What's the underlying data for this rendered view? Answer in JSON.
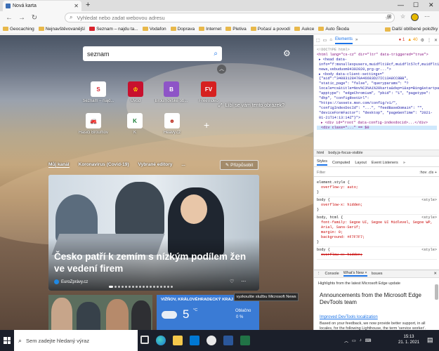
{
  "browser": {
    "tab_title": "Nová karta",
    "address_placeholder": "Vyhledat nebo zadat webovou adresu",
    "bookmarks": [
      "Geocaching",
      "Nejnavštěvovanější",
      "Seznam – najdu ta...",
      "Vodafon",
      "Doprava",
      "Internet",
      "Pletiva",
      "Počasí a povodí",
      "Aukce",
      "Auto Škoda"
    ],
    "bookmarks_more": "Další oblíbené položky"
  },
  "ntp": {
    "search_value": "seznam",
    "like_text": "Líbí se vám tento obrázek?",
    "tiles": [
      {
        "label": "Seznam – najd...",
        "glyph": "S",
        "color": "#d9232d"
      },
      {
        "label": "Úvod",
        "glyph": "♔",
        "color": "#c8102e"
      },
      {
        "label": "Broumovské ob...",
        "glyph": "B",
        "color": "#8e54c7"
      },
      {
        "label": "FreeVideo",
        "glyph": "FV",
        "color": "#d6201f"
      },
      {
        "label": "Hasiči Broumov",
        "glyph": "🚒",
        "color": "#e14f3c"
      },
      {
        "label": "K",
        "glyph": "K",
        "color": "#1a7f37"
      },
      {
        "label": "Heavy.cz",
        "glyph": "☻",
        "color": "#c0392b"
      }
    ],
    "feed_nav": [
      "Můj kanál",
      "Koronavirus (Covid-19)",
      "Vybrané editory",
      "..."
    ],
    "customize": "Přizpůsobit",
    "hero_headline": "Česko patří k zemím s nízkým podílem žen ve vedení firem",
    "hero_source": "EuroZprávy.cz",
    "weather": {
      "location": "VIŽŇOV, KRÁLOVÉHRADECKÝ KRAJ",
      "temp": "5",
      "unit": "°C",
      "condition": "Oblačno",
      "condition2": "0 %"
    },
    "tooltip": "vyzkoušte službu Microsoft News"
  },
  "devtools": {
    "tabs": [
      "Elements"
    ],
    "errors": "1",
    "warnings": "40",
    "dom_lines": [
      "<!DOCTYPE html>",
      "<html lang=\"cs-cz\" dir=\"ltr\" data-triggered=\"true\">",
      "▸ <head data-info=\"f:msnallexpusers,muidflt19cf,muidflt57cf,muidflt158cf,startedge3cf,moneyhplcf,platagrhc1cf,complianceshlcf,gallerysh3cf,bing-news,vebuduom04302020,prg-gr...\">",
      "▸ <body data-client-settings=\"{\"aid\":\"34083128470A46683D27IC13A8CC8BB\", \"static_page\": \"false\", \"queryparams\": \"?locale=cs&title=Nov%C3%A1%20karta&dsp=1&sp=Bing&startpage=1&PC=U531\", \"apptype\": \"edgeChromium\", \"pbid\": \"1\", \"pagetype\": \"dhp\", \"configRootUrl\": \"https://assets.msn.com/config/v1/\", \"configIndexDocId\": \"...\", \"feedBaseDomain\": \"\", \"deviceFormFactor\": \"desktop\", \"pageGenTime\": \"2021-01-21T14:13:14Z\"}\">",
      "  ▸ <div id=\"root\" data-config-indexdocid>...</div>",
      "    <div class=\"...\" == $0"
    ],
    "crumbs": [
      "html",
      "body.js-focus-visible"
    ],
    "style_tabs": [
      "Styles",
      "Computed",
      "Layout",
      "Event Listeners",
      "»"
    ],
    "filter_placeholder": "Filter",
    "filter_tools": ":hov  .cls  +",
    "rules": [
      {
        "selector": "element.style {",
        "source": "",
        "props": [
          "overflow-y: auto;"
        ],
        "strike": false
      },
      {
        "selector": "body {",
        "source": "<style>",
        "props": [
          "overflow-x: hidden;"
        ],
        "strike": false
      },
      {
        "selector": "body, html {",
        "source": "<style>",
        "props": [
          "font-family: Segoe UI, Segoe UI Midlevel, Segoe WP, Arial, Sans-Serif;",
          "margin: 0;",
          "background: #F7F7F7;"
        ],
        "strike": false
      },
      {
        "selector": "body {",
        "source": "<style>",
        "props": [
          "overflow-x: hidden;"
        ],
        "strike": true
      }
    ],
    "drawer_tabs": [
      "⋮",
      "Console",
      "What's New ×",
      "Issues"
    ],
    "whatsnew_sub": "Highlights from the latest Microsoft Edge update",
    "whatsnew_title": "Announcements from the Microsoft Edge DevTools team",
    "whatsnew_link": "Improved DevTools localization",
    "whatsnew_body": "Based on your feedback, we now provide better support, in all locales, for the following Lighthouse, the term 'service worker'. Network tool"
  },
  "taskbar": {
    "search_text": "Sem zadejte hledaný výraz",
    "time": "15:13",
    "date": "21. 1. 2021"
  }
}
